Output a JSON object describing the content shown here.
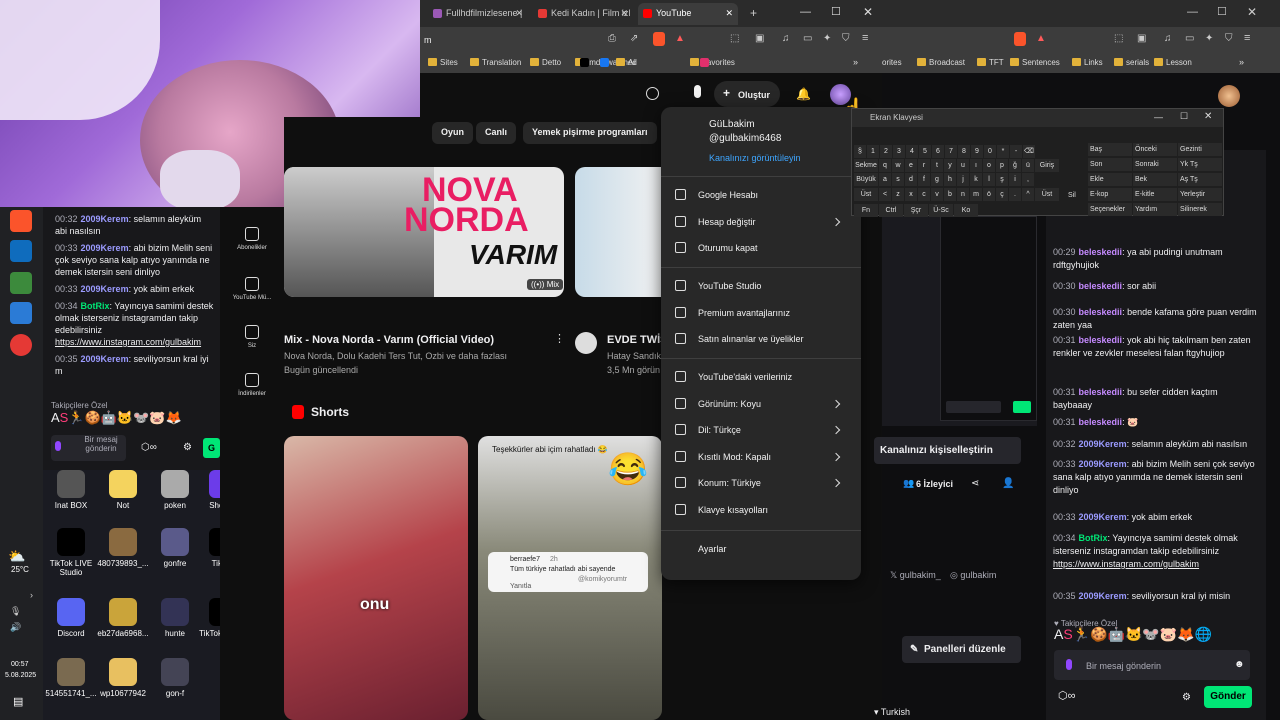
{
  "browser": {
    "tabs": [
      {
        "label": "Fullhdfilmizlesene |",
        "color": "#9b59b6"
      },
      {
        "label": "Kedi Kadın | Film izl",
        "color": "#e53935"
      },
      {
        "label": "YouTube",
        "color": "#ff0000"
      }
    ],
    "address_text": "m",
    "bookmarks": [
      "Sites",
      "Translation",
      "Detto",
      "Imdb watched",
      "Ai",
      "Favorites"
    ]
  },
  "youtube": {
    "create_label": "Oluştur",
    "chips": [
      "Oyun",
      "Canlı",
      "Yemek pişirme programları"
    ],
    "sidebar": [
      {
        "label": "Abonelikler",
        "icon": "subscriptions-icon"
      },
      {
        "label": "YouTube Mü...",
        "icon": "youtube-music-icon"
      },
      {
        "label": "Siz",
        "icon": "you-icon"
      },
      {
        "label": "İndirilenler",
        "icon": "downloads-icon"
      }
    ],
    "video1": {
      "thumb_line1": "NOVA",
      "thumb_line2": "NORDA",
      "thumb_line3": "VARIM",
      "title": "Mix - Nova Norda - Varım (Official Video)",
      "meta": "Nova Norda, Dolu Kadehi Ters Tut, Ozbi ve daha fazlası",
      "updated": "Bugün güncellendi",
      "badge": "Mix"
    },
    "video2": {
      "title": "EVDE TWİS",
      "channel": "Hatay Sandık",
      "views": "3,5 Mn görün"
    },
    "shorts_label": "Shorts",
    "short1_caption": "onu",
    "short2": {
      "top_text": "Teşekkürler abi içim rahatladı 😂",
      "comment_user": "berraefe7",
      "comment_age": "2h",
      "comment_text": "Tüm türkiye rahatladı abi sayende",
      "comment_handle": "@komikyorumtr",
      "reply": "Yanıtla"
    }
  },
  "account_menu": {
    "name": "GüLbakim",
    "handle": "@gulbakim6468",
    "view_channel": "Kanalınızı görüntüleyin",
    "group1": [
      "Google Hesabı",
      "Hesap değiştir",
      "Oturumu kapat"
    ],
    "group2": [
      "YouTube Studio",
      "Premium avantajlarınız",
      "Satın alınanlar ve üyelikler"
    ],
    "group3": [
      "YouTube'daki verileriniz",
      "Görünüm: Koyu",
      "Dil: Türkçe",
      "Kısıtlı Mod: Kapalı",
      "Konum: Türkiye",
      "Klavye kısayolları"
    ],
    "settings": "Ayarlar"
  },
  "osk": {
    "title": "Ekran Klavyesi",
    "rows": [
      [
        "§",
        "1",
        "2",
        "3",
        "4",
        "5",
        "6",
        "7",
        "8",
        "9",
        "0",
        "*",
        "-",
        "⌫"
      ],
      [
        "Sekme",
        "q",
        "w",
        "e",
        "r",
        "t",
        "y",
        "u",
        "ı",
        "o",
        "p",
        "ğ",
        "ü",
        "Giriş"
      ],
      [
        "Büyük",
        "a",
        "s",
        "d",
        "f",
        "g",
        "h",
        "j",
        "k",
        "l",
        "ş",
        "i",
        ","
      ],
      [
        "Üst",
        "<",
        "z",
        "x",
        "c",
        "v",
        "b",
        "n",
        "m",
        "ö",
        "ç",
        ".",
        "^",
        "Üst"
      ],
      [
        "Fn",
        "Ctrl",
        "Şçr",
        "Ü-Sc",
        "Ko"
      ]
    ],
    "side_keys": [
      [
        "Baş",
        "Önceki",
        "Gezinti"
      ],
      [
        "Son",
        "Sonraki",
        "Yk Tş"
      ],
      [
        "Ekle",
        "Bek",
        "Aş Tş"
      ],
      [
        "E-kop",
        "E-kitle",
        "Yerleştir"
      ],
      [
        "Seçenekler",
        "Yardım",
        "Silinerek"
      ]
    ],
    "extra_label": "Sil"
  },
  "desktop": {
    "icons": [
      "Inat BOX",
      "Not",
      "poken",
      "Shopier",
      "TikTok LIVE Studio",
      "480739893_...",
      "gonfre",
      "TikTok",
      "Discord",
      "eb27da6968...",
      "hunte",
      "TikTok Studio",
      "514551741_...",
      "wp10677942",
      "gon-f"
    ],
    "weather": "25°C",
    "time": "00:57",
    "date": "5.08.2025"
  },
  "small_chat": {
    "messages": [
      {
        "time": "00:32",
        "user": "2009Kerem",
        "text": "selamın aleyküm abi nasılsın",
        "color": "#9b9bff"
      },
      {
        "time": "00:33",
        "user": "2009Kerem",
        "text": "abi bizim Melih seni çok seviyo sana kalp atıyo yanımda ne demek istersin seni dinliyo",
        "color": "#9b9bff"
      },
      {
        "time": "00:33",
        "user": "2009Kerem",
        "text": "yok abim erkek",
        "color": "#9b9bff"
      },
      {
        "time": "00:34",
        "user": "BotRix",
        "text": "Yayıncıya samimi destek olmak isterseniz instagramdan takip edebilirsiniz",
        "link": "https://www.instagram.com/gulbakim",
        "color": "#00e676"
      },
      {
        "time": "00:35",
        "user": "2009Kerem",
        "text": "seviliyorsun kral iyi m",
        "color": "#9b9bff"
      }
    ],
    "supporters_label": "Takipçilere Özel",
    "input_placeholder": "Bir mesaj gönderin",
    "send": "G"
  },
  "twitch": {
    "bookmarks": [
      "orites",
      "Broadcast",
      "TFT",
      "Sentences",
      "Links",
      "serials",
      "Lesson"
    ],
    "personalize": "Kanalınızı kişiselleştirin",
    "viewers": "6 İzleyici",
    "socials": [
      "gulbakim_",
      "gulbakim"
    ],
    "edit_panels": "Panelleri düzenle",
    "language": "Turkish",
    "chat": [
      {
        "time": "",
        "user": "",
        "text": "edebilirsiniz",
        "link": "https://www.instagram.com/gulbakim",
        "color": "#efeff1"
      },
      {
        "time": "00:29",
        "user": "beleskedii",
        "text": "ya abi pudingi unutmam rdftgyhujiok",
        "color": "#c58aff"
      },
      {
        "time": "00:30",
        "user": "beleskedii",
        "text": "sor abii",
        "color": "#c58aff"
      },
      {
        "time": "00:30",
        "user": "beleskedii",
        "text": "bende kafama göre puan verdim zaten yaa",
        "color": "#c58aff"
      },
      {
        "time": "00:31",
        "user": "beleskedii",
        "text": "yok abi hiç takılmam ben zaten renkler ve zevkler meselesi falan ftgyhujiop",
        "color": "#c58aff"
      },
      {
        "time": "00:31",
        "user": "beleskedii",
        "text": "bu sefer cidden kaçtım baybaaay",
        "color": "#c58aff"
      },
      {
        "time": "00:31",
        "user": "beleskedii",
        "text": "🐷",
        "color": "#c58aff"
      },
      {
        "time": "00:32",
        "user": "2009Kerem",
        "text": "selamın aleyküm abi nasılsın",
        "color": "#9b9bff"
      },
      {
        "time": "00:33",
        "user": "2009Kerem",
        "text": "abi bizim Melih seni çok seviyo sana kalp atıyo yanımda ne demek istersin seni dinliyo",
        "color": "#9b9bff"
      },
      {
        "time": "00:33",
        "user": "2009Kerem",
        "text": "yok abim erkek",
        "color": "#9b9bff"
      },
      {
        "time": "00:34",
        "user": "BotRix",
        "text": "Yayıncıya samimi destek olmak isterseniz instagramdan takip edebilirsiniz",
        "link": "https://www.instagram.com/gulbakim",
        "color": "#00e676"
      },
      {
        "time": "00:35",
        "user": "2009Kerem",
        "text": "seviliyorsun kral iyi misin",
        "color": "#9b9bff"
      }
    ],
    "supporters_label": "Takipçilere Özel",
    "input_placeholder": "Bir mesaj gönderin",
    "send": "Gönder",
    "top_fragment": "ya"
  }
}
